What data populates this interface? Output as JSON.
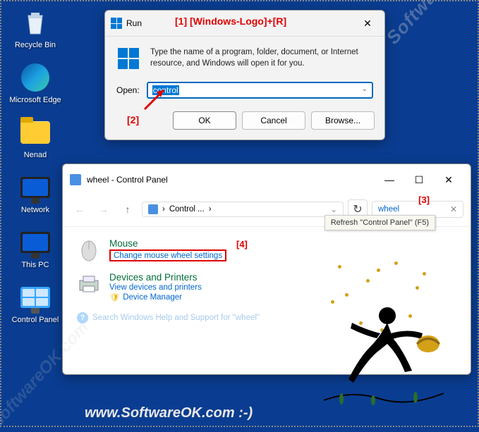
{
  "desktop": {
    "icons": [
      {
        "label": "Recycle Bin"
      },
      {
        "label": "Microsoft Edge"
      },
      {
        "label": "Nenad"
      },
      {
        "label": "Network"
      },
      {
        "label": "This PC"
      },
      {
        "label": "Control Panel"
      }
    ]
  },
  "run": {
    "title": "Run",
    "description": "Type the name of a program, folder, document, or Internet resource, and Windows will open it for you.",
    "open_label": "Open:",
    "input_value": "control",
    "buttons": {
      "ok": "OK",
      "cancel": "Cancel",
      "browse": "Browse..."
    }
  },
  "annotations": {
    "a1": "[1]  [Windows-Logo]+[R]",
    "a2": "[2]",
    "a3": "[3]",
    "a4": "[4]"
  },
  "cp": {
    "title": "wheel - Control Panel",
    "breadcrumb": "Control ...",
    "breadcrumb_sep": "›",
    "breadcrumb_chev": "›",
    "search_value": "wheel",
    "tooltip": "Refresh \"Control Panel\" (F5)",
    "items": {
      "mouse": {
        "title": "Mouse",
        "link": "Change mouse wheel settings"
      },
      "devices": {
        "title": "Devices and Printers",
        "link1": "View devices and printers",
        "link2": "Device Manager"
      }
    },
    "help": "Search Windows Help and Support for \"wheel\""
  },
  "watermark": {
    "diag": "SoftwareOK.com",
    "footer": "www.SoftwareOK.com :-)"
  }
}
